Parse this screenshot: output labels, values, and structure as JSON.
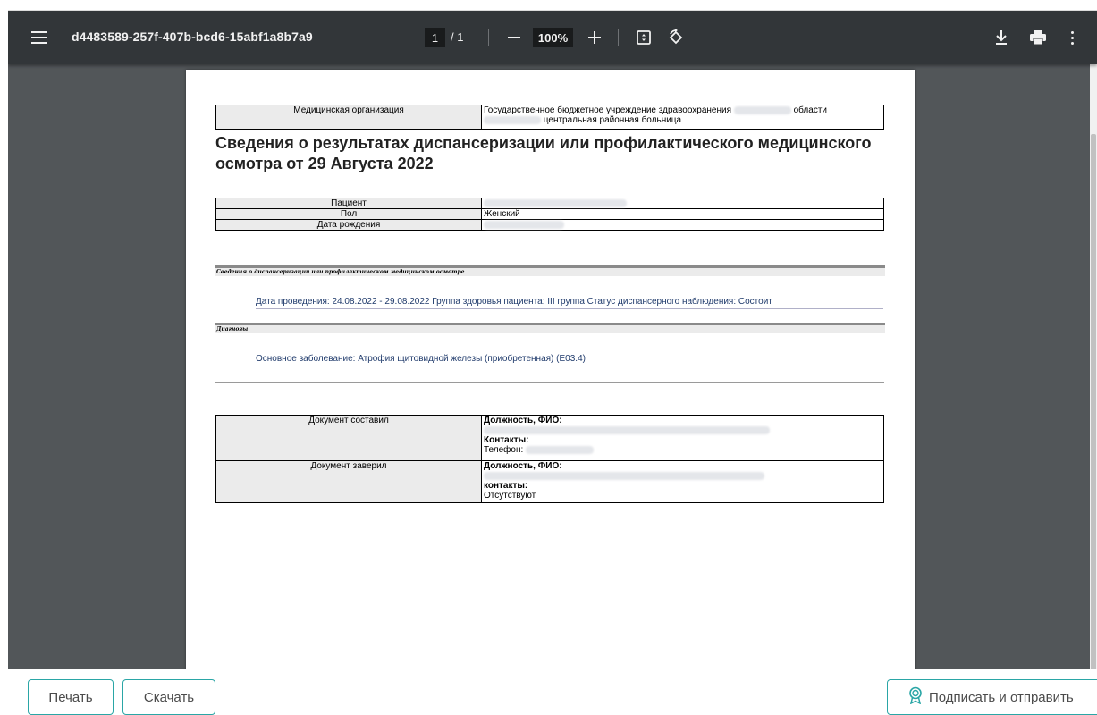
{
  "toolbar": {
    "title": "d4483589-257f-407b-bcd6-15abf1a8b7a9",
    "page_current": "1",
    "page_total": "/ 1",
    "zoom": "100%"
  },
  "document": {
    "org_label": "Медицинская организация",
    "org_value_line1": "Государственное бюджетное учреждение здравоохранения",
    "org_value_line1_end": "области",
    "org_value_line2": "центральная районная больница",
    "heading": "Сведения о результатах диспансеризации или профилактического медицинского осмотра от 29 Августа 2022",
    "patient_rows": [
      {
        "label": "Пациент",
        "value": ""
      },
      {
        "label": "Пол",
        "value": "Женский"
      },
      {
        "label": "Дата рождения",
        "value": ""
      }
    ],
    "section1_title": "Сведения о диспансеризации или профилактическом медицинском осмотре",
    "section1_text": "Дата проведения: 24.08.2022 - 29.08.2022 Группа здоровья пациента: III группа Статус диспансерного наблюдения: Состоит",
    "section2_title": "Диагнозы",
    "section2_text": "Основное заболевание: Атрофия щитовидной железы (приобретенная) (E03.4)",
    "composed_label": "Документ составил",
    "composed_position": "Должность, ФИО:",
    "composed_contacts": "Контакты:",
    "composed_phone": "Телефон:",
    "certified_label": "Документ заверил",
    "certified_position": "Должность, ФИО:",
    "certified_contacts": "контакты:",
    "certified_absent": "Отсутствуют"
  },
  "buttons": {
    "print": "Печать",
    "download": "Скачать",
    "sign_send": "Подписать и отправить"
  },
  "colors": {
    "toolbar": "#323639",
    "viewer_bg": "#525659",
    "accent": "#2aa6a6"
  }
}
